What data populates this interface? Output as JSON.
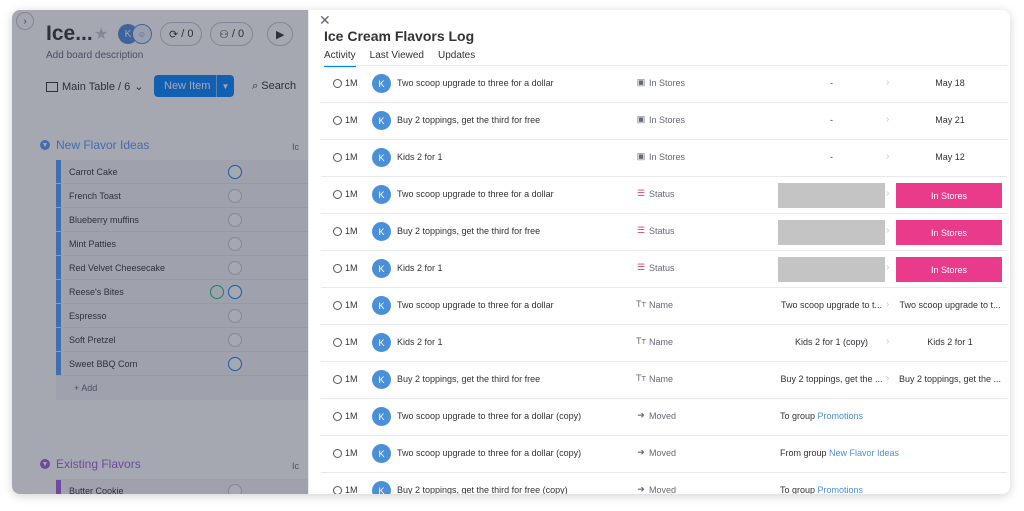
{
  "board": {
    "title": "Ice...",
    "avatar_initial": "K",
    "pill_1": "/ 0",
    "pill_2": "/ 0",
    "pill_3": "/0",
    "description": "Add board description",
    "main_table": "Main Table / 6",
    "new_item": "New Item",
    "search": "Search",
    "groups": [
      {
        "name": "New Flavor Ideas",
        "color": "#579bfc",
        "label": "Ic"
      },
      {
        "name": "Existing Flavors",
        "color": "#a25ddc",
        "label": "Ic"
      }
    ],
    "items": [
      "Carrot Cake",
      "French Toast",
      "Blueberry muffins",
      "Mint Patties",
      "Red Velvet Cheesecake",
      "Reese's Bites",
      "Espresso",
      "Soft Pretzel",
      "Sweet BBQ Corn"
    ],
    "add_label": "+ Add",
    "existing_item": "Butter Cookie"
  },
  "panel": {
    "title": "Ice Cream Flavors  Log",
    "tabs": [
      "Activity",
      "Last Viewed",
      "Updates"
    ],
    "rows": [
      {
        "time": "1M",
        "avatar": "K",
        "name": "Two scoop upgrade to three for a dollar",
        "column": "In Stores",
        "from": "-",
        "to": "May 18"
      },
      {
        "time": "1M",
        "avatar": "K",
        "name": "Buy 2 toppings, get the third for free",
        "column": "In Stores",
        "from": "-",
        "to": "May 21"
      },
      {
        "time": "1M",
        "avatar": "K",
        "name": "Kids 2 for 1",
        "column": "In Stores",
        "from": "-",
        "to": "May 12"
      },
      {
        "time": "1M",
        "avatar": "K",
        "name": "Two scoop upgrade to three for a dollar",
        "column": "Status",
        "to": "In Stores"
      },
      {
        "time": "1M",
        "avatar": "K",
        "name": "Buy 2 toppings, get the third for free",
        "column": "Status",
        "to": "In Stores"
      },
      {
        "time": "1M",
        "avatar": "K",
        "name": "Kids 2 for 1",
        "column": "Status",
        "to": "In Stores"
      },
      {
        "time": "1M",
        "avatar": "K",
        "name": "Two scoop upgrade to three for a dollar",
        "column": "Name",
        "from": "Two scoop upgrade to t...",
        "to": "Two scoop upgrade to t..."
      },
      {
        "time": "1M",
        "avatar": "K",
        "name": "Kids 2 for 1",
        "column": "Name",
        "from": "Kids 2 for 1 (copy)",
        "to": "Kids 2 for 1"
      },
      {
        "time": "1M",
        "avatar": "K",
        "name": "Buy 2 toppings, get the third for free",
        "column": "Name",
        "from": "Buy 2 toppings, get the ...",
        "to": "Buy 2 toppings, get the ..."
      },
      {
        "time": "1M",
        "avatar": "K",
        "name": "Two scoop upgrade to three for a dollar (copy)",
        "column": "Moved",
        "prefix": "To group ",
        "link": "Promotions"
      },
      {
        "time": "1M",
        "avatar": "K",
        "name": "Two scoop upgrade to three for a dollar (copy)",
        "column": "Moved",
        "prefix": "From group ",
        "link": "New Flavor Ideas"
      },
      {
        "time": "1M",
        "avatar": "K",
        "name": "Buy 2 toppings, get the third for free (copy)",
        "column": "Moved",
        "prefix": "To group ",
        "link": "Promotions"
      }
    ]
  },
  "colors": {
    "accent": "#0085ff",
    "status_pink": "#ea3a8c",
    "status_gray": "#c4c4c4"
  }
}
